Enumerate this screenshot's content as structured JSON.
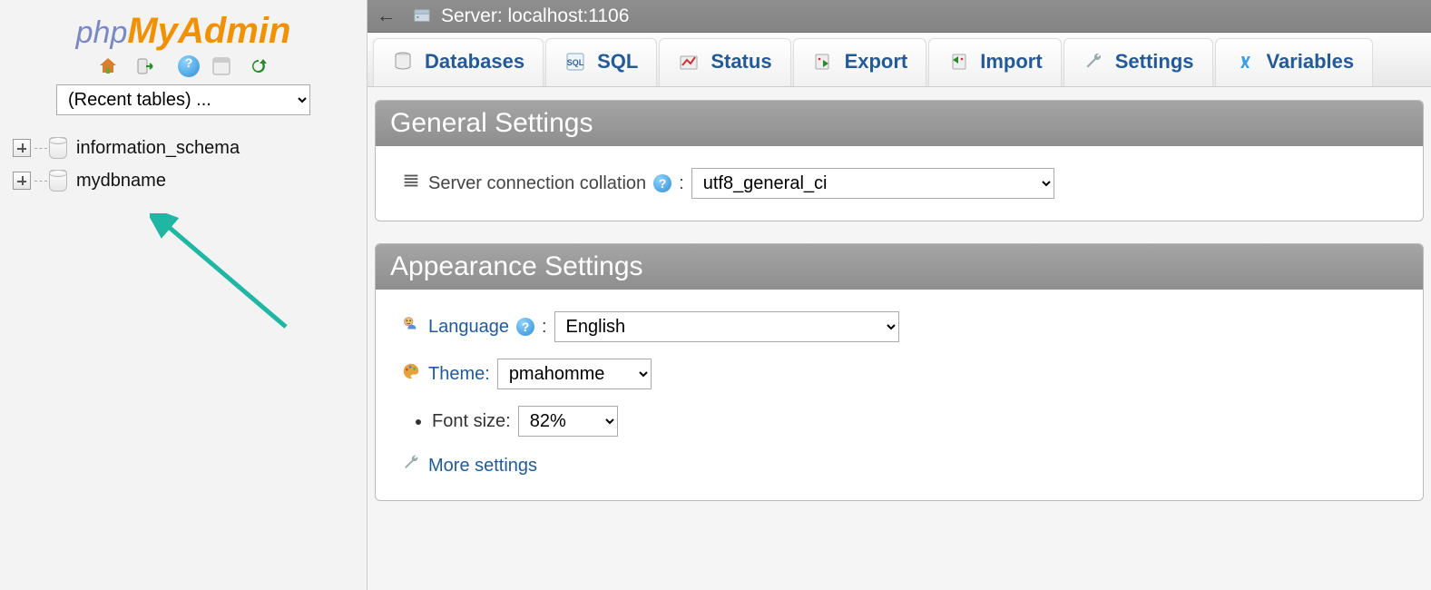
{
  "logo": {
    "php": "php",
    "my": "My",
    "admin": "Admin"
  },
  "sidebar": {
    "recent_placeholder": "(Recent tables) ...",
    "databases": [
      {
        "name": "information_schema"
      },
      {
        "name": "mydbname"
      }
    ]
  },
  "server": {
    "back": "←",
    "label": "Server: localhost:1106"
  },
  "tabs": [
    {
      "label": "Databases",
      "icon": "databases"
    },
    {
      "label": "SQL",
      "icon": "sql"
    },
    {
      "label": "Status",
      "icon": "status"
    },
    {
      "label": "Export",
      "icon": "export"
    },
    {
      "label": "Import",
      "icon": "import"
    },
    {
      "label": "Settings",
      "icon": "settings"
    },
    {
      "label": "Variables",
      "icon": "variables"
    }
  ],
  "panels": {
    "general": {
      "title": "General Settings",
      "collation_label": "Server connection collation",
      "collation_value": "utf8_general_ci"
    },
    "appearance": {
      "title": "Appearance Settings",
      "language_label": "Language",
      "language_value": "English",
      "theme_label": "Theme:",
      "theme_value": "pmahomme",
      "fontsize_label": "Font size:",
      "fontsize_value": "82%",
      "more": "More settings"
    }
  }
}
